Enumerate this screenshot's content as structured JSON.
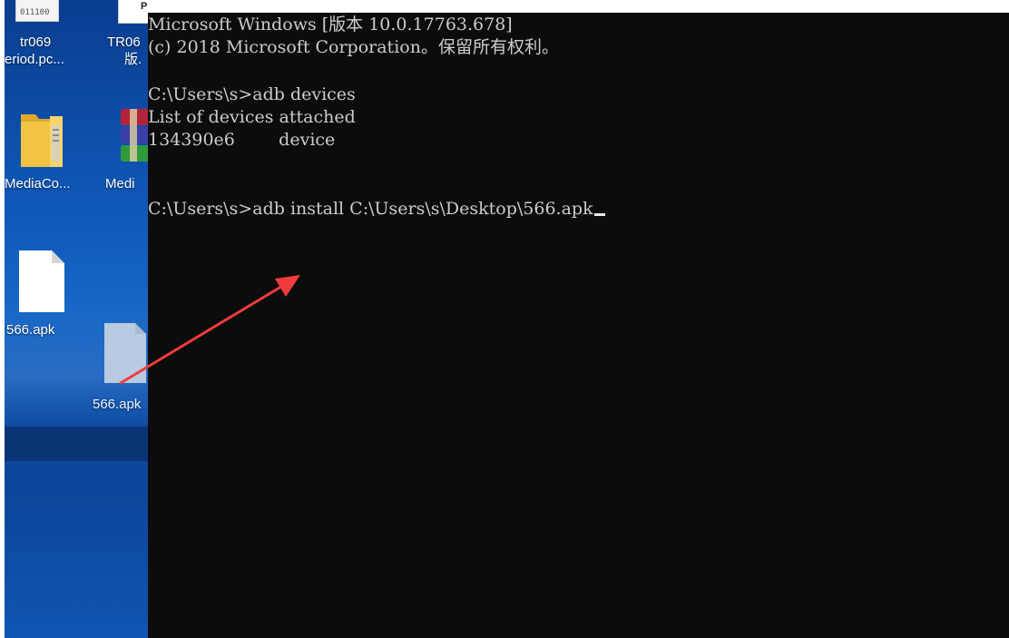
{
  "desktop": {
    "icons": [
      {
        "name": "tr069-file",
        "label_line1": "tr069",
        "label_line2": "eriod.pc...",
        "icon": "file-binary-icon",
        "icon_text": "011100"
      },
      {
        "name": "tr06-file",
        "label_line1": "TR06",
        "label_line2": "版.",
        "icon": "document-icon",
        "icon_text": "P"
      },
      {
        "name": "mediaco-folder",
        "label_line1": "MediaCo...",
        "icon": "folder-icon"
      },
      {
        "name": "medi-archive",
        "label_line1": "Medi",
        "icon": "winrar-archive-icon"
      },
      {
        "name": "apk-file",
        "label_line1": "566.apk",
        "icon": "file-icon"
      },
      {
        "name": "apk-file-dragging",
        "label_line1": "566.apk",
        "icon": "file-icon"
      }
    ],
    "colors": {
      "wallpaper": "#0f56b5",
      "band": "#0a3474"
    }
  },
  "console": {
    "lines": [
      "Microsoft Windows [版本 10.0.17763.678]",
      "(c) 2018 Microsoft Corporation。保留所有权利。",
      "",
      "C:\\Users\\s>adb devices",
      "List of devices attached",
      "134390e6        device",
      "",
      "",
      "C:\\Users\\s>adb install C:\\Users\\s\\Desktop\\566.apk"
    ],
    "colors": {
      "background": "#0c0c0c",
      "text": "#cccccc"
    }
  },
  "annotation": {
    "arrow_color": "#f03c3c",
    "icon": "red-arrow-icon"
  }
}
